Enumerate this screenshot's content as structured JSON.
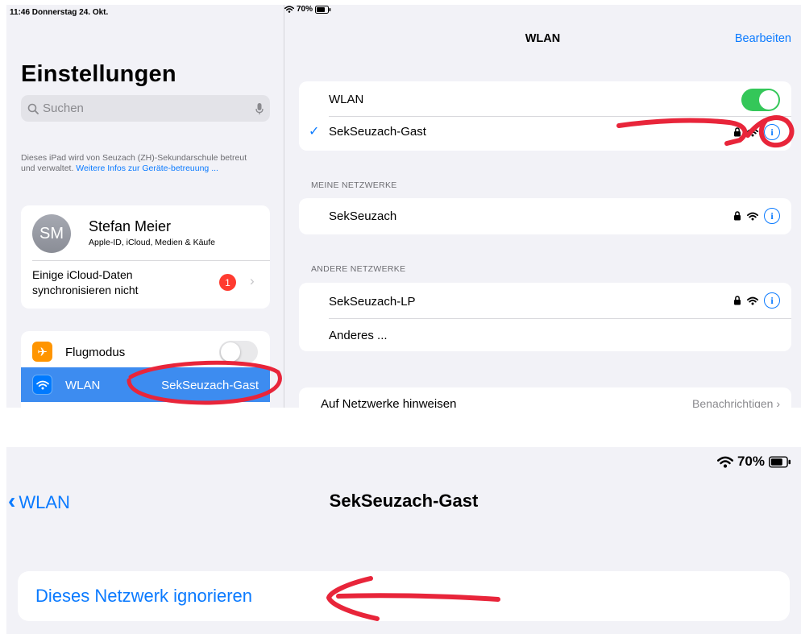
{
  "top": {
    "status": {
      "time_date": "11:46  Donnerstag 24. Okt.",
      "battery": "70%"
    },
    "sidebar": {
      "title": "Einstellungen",
      "search_placeholder": "Suchen",
      "managed_text": "Dieses iPad wird von Seuzach (ZH)-Sekundarschule betreut und verwaltet.",
      "managed_link": "Weitere Infos zur Geräte-betreuung ...",
      "profile": {
        "initials": "SM",
        "name": "Stefan Meier",
        "subtitle": "Apple-ID, iCloud, Medien & Käufe"
      },
      "icloud_line1": "Einige iCloud-Daten",
      "icloud_line2": "synchronisieren nicht",
      "icloud_badge": "1",
      "items": [
        {
          "label": "Flugmodus",
          "toggle": "off"
        },
        {
          "label": "WLAN",
          "value": "SekSeuzach-Gast",
          "selected": true
        }
      ]
    },
    "detail": {
      "title": "WLAN",
      "edit": "Bearbeiten",
      "wlan_label": "WLAN",
      "wlan_toggle": "on",
      "current_network": "SekSeuzach-Gast",
      "my_networks_header": "MEINE NETZWERKE",
      "my_networks": [
        {
          "name": "SekSeuzach"
        }
      ],
      "other_networks_header": "ANDERE NETZWERKE",
      "other_networks": [
        {
          "name": "SekSeuzach-LP"
        },
        {
          "name": "Anderes ..."
        }
      ],
      "notify_label": "Auf Netzwerke hinweisen",
      "notify_value": "Benachrichtigen"
    }
  },
  "bottom": {
    "battery": "70%",
    "back_label": "WLAN",
    "title": "SekSeuzach-Gast",
    "ignore_button": "Dieses Netzwerk ignorieren"
  },
  "colors": {
    "accent": "#0a7aff",
    "toggle_on": "#34c759",
    "badge": "#ff3b30",
    "annotation": "#e8253a"
  }
}
